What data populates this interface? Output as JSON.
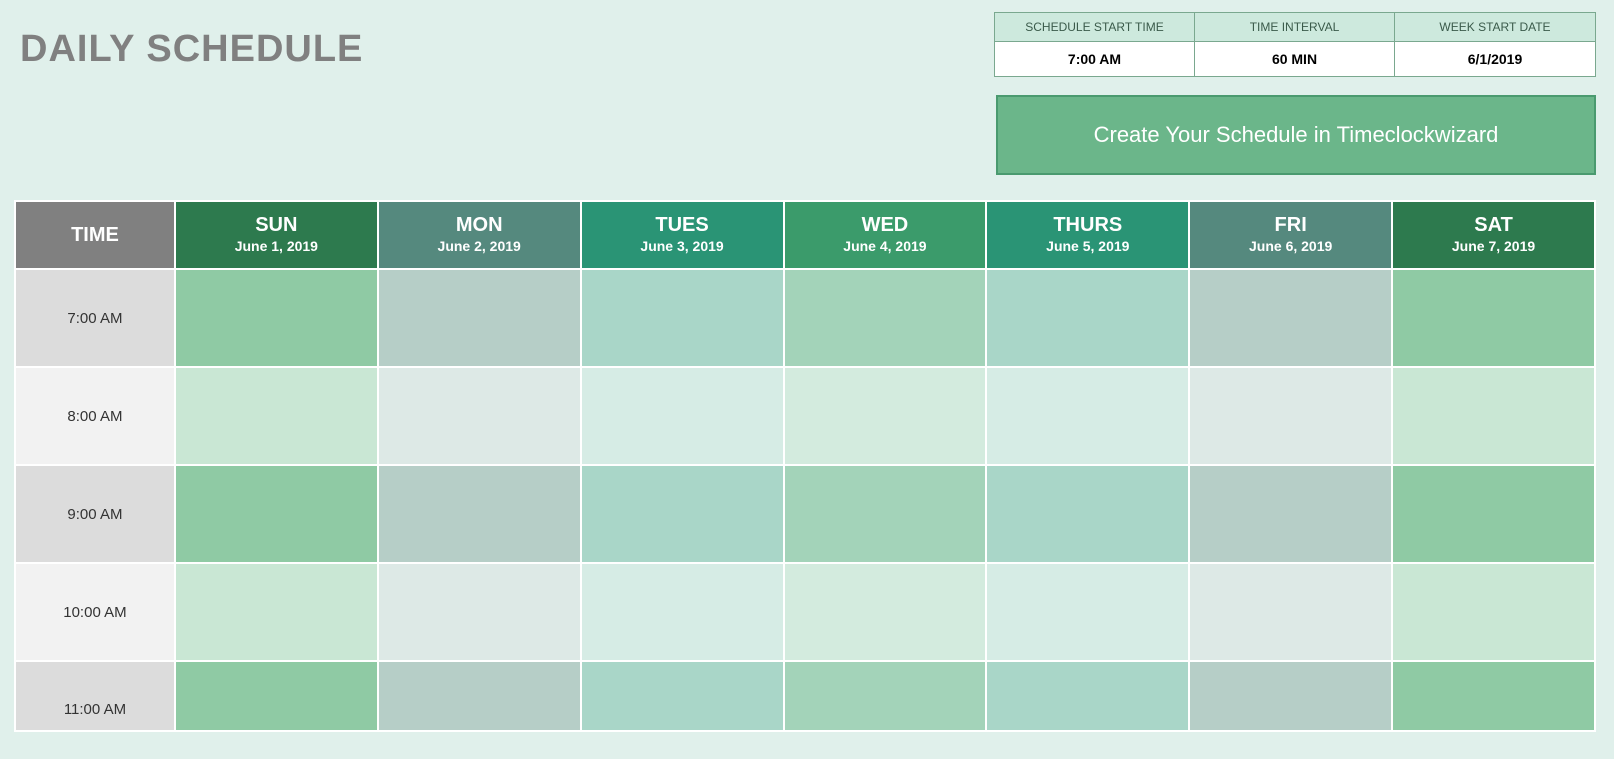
{
  "title": "DAILY SCHEDULE",
  "settings": {
    "cols": [
      {
        "label": "SCHEDULE START TIME",
        "value": "7:00 AM"
      },
      {
        "label": "TIME INTERVAL",
        "value": "60 MIN"
      },
      {
        "label": "WEEK START DATE",
        "value": "6/1/2019"
      }
    ]
  },
  "cta_label": "Create Your Schedule in Timeclockwizard",
  "table": {
    "time_header": "TIME",
    "days": [
      {
        "abbr": "SUN",
        "date": "June 1, 2019"
      },
      {
        "abbr": "MON",
        "date": "June 2, 2019"
      },
      {
        "abbr": "TUES",
        "date": "June 3, 2019"
      },
      {
        "abbr": "WED",
        "date": "June 4, 2019"
      },
      {
        "abbr": "THURS",
        "date": "June 5, 2019"
      },
      {
        "abbr": "FRI",
        "date": "June 6, 2019"
      },
      {
        "abbr": "SAT",
        "date": "June 7, 2019"
      }
    ],
    "times": [
      "7:00 AM",
      "8:00 AM",
      "9:00 AM",
      "10:00 AM",
      "11:00 AM"
    ]
  }
}
